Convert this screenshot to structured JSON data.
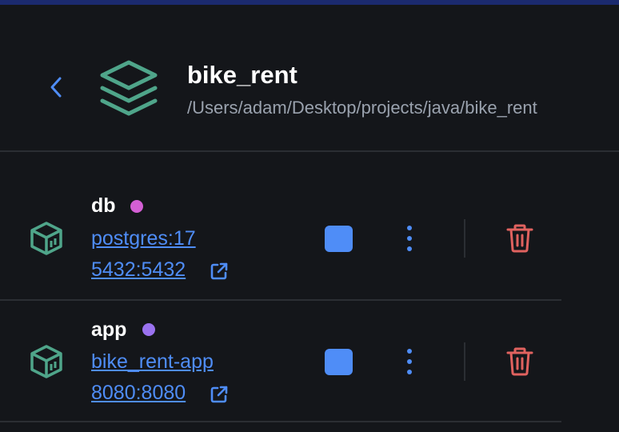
{
  "project": {
    "name": "bike_rent",
    "path": "/Users/adam/Desktop/projects/java/bike_rent"
  },
  "icons": {
    "back": "chevron-left-icon",
    "project": "layers-stack-icon",
    "container": "container-box-icon",
    "external": "external-link-icon",
    "stop": "stop-square-icon",
    "menu": "kebab-menu-icon",
    "delete": "trash-icon"
  },
  "colors": {
    "background": "#14161a",
    "accent": "#4f8df7",
    "project_icon": "#4fa58a",
    "danger": "#e0625f",
    "path_text": "#9aa2ae",
    "top_strip": "#1b2a6f"
  },
  "services": [
    {
      "name": "db",
      "status_color": "#d45fd4",
      "image": "postgres:17",
      "ports": "5432:5432"
    },
    {
      "name": "app",
      "status_color": "#9a72ef",
      "image": "bike_rent-app",
      "ports": "8080:8080"
    }
  ]
}
